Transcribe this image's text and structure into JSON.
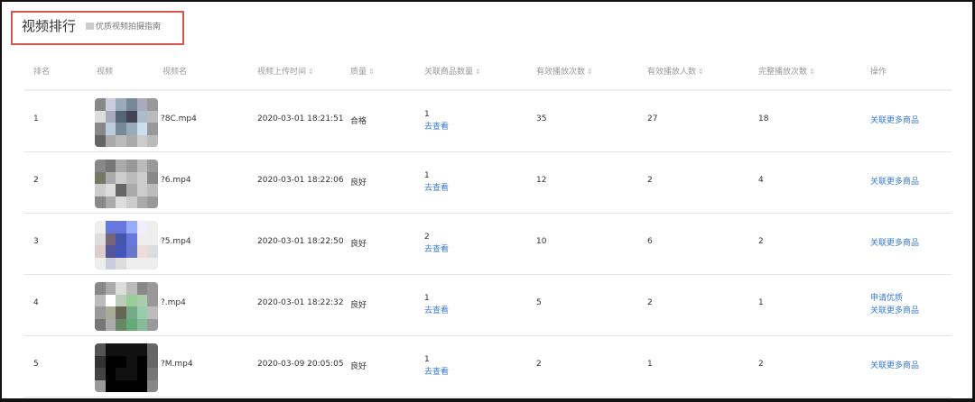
{
  "header": {
    "title": "视频排行",
    "guide_link": "优质视频拍摄指南"
  },
  "columns": [
    {
      "label": "排名",
      "sortable": false
    },
    {
      "label": "视频",
      "sortable": false
    },
    {
      "label": "视频名",
      "sortable": false
    },
    {
      "label": "视频上传时间",
      "sortable": true
    },
    {
      "label": "质量",
      "sortable": true
    },
    {
      "label": "关联商品数量",
      "sortable": true
    },
    {
      "label": "有效播放次数",
      "sortable": true
    },
    {
      "label": "有效播放人数",
      "sortable": true
    },
    {
      "label": "完整播放次数",
      "sortable": true
    },
    {
      "label": "操作",
      "sortable": false
    }
  ],
  "sort_icon": "⇕",
  "rows": [
    {
      "rank": "1",
      "name": "?8C.mp4",
      "time": "2020-03-01 18:21:51",
      "quality": "合格",
      "goods": "1",
      "view": "去查看",
      "plays": "35",
      "viewers": "27",
      "full": "18",
      "actions": [
        "关联更多商品"
      ],
      "thumb": [
        "#888",
        "#ccd",
        "#9ab",
        "#789",
        "#aab",
        "#999",
        "#ddd",
        "#aab",
        "#567",
        "#445",
        "#abc",
        "#bbb",
        "#888",
        "#bcd",
        "#789",
        "#9ab",
        "#cde",
        "#999",
        "#666",
        "#aaa",
        "#bbb",
        "#aaa",
        "#ccc",
        "#bbb"
      ]
    },
    {
      "rank": "2",
      "name": "?6.mp4",
      "time": "2020-03-01 18:22:06",
      "quality": "良好",
      "goods": "1",
      "view": "去查看",
      "plays": "12",
      "viewers": "2",
      "full": "4",
      "actions": [
        "关联更多商品"
      ],
      "thumb": [
        "#888",
        "#777",
        "#aaa",
        "#999",
        "#bbb",
        "#999",
        "#776",
        "#aaa",
        "#ccc",
        "#bbb",
        "#ccc",
        "#888",
        "#ccc",
        "#ddd",
        "#666",
        "#aaa",
        "#ccc",
        "#bbb",
        "#888",
        "#aaa",
        "#ddd",
        "#ccc",
        "#aaa",
        "#999"
      ]
    },
    {
      "rank": "3",
      "name": "?5.mp4",
      "time": "2020-03-01 18:22:50",
      "quality": "良好",
      "goods": "2",
      "view": "去查看",
      "plays": "10",
      "viewers": "6",
      "full": "2",
      "actions": [
        "关联更多商品"
      ],
      "thumb": [
        "#eee",
        "#67d",
        "#67d",
        "#9af",
        "#eef",
        "#eee",
        "#ddd",
        "#767",
        "#45a",
        "#67d",
        "#eee",
        "#eee",
        "#dcc",
        "#559",
        "#45b",
        "#67c",
        "#edd",
        "#ddd",
        "#eee",
        "#ccd",
        "#ddd",
        "#eee",
        "#eee",
        "#eee"
      ]
    },
    {
      "rank": "4",
      "name": "?.mp4",
      "time": "2020-03-01 18:22:32",
      "quality": "良好",
      "goods": "1",
      "view": "去查看",
      "plays": "5",
      "viewers": "2",
      "full": "1",
      "actions": [
        "申请优质",
        "关联更多商品"
      ],
      "thumb": [
        "#888",
        "#aaa",
        "#ddd",
        "#bbb",
        "#888",
        "#999",
        "#bbb",
        "#fff",
        "#bcb",
        "#9c9",
        "#aca",
        "#999",
        "#999",
        "#aa9",
        "#665",
        "#7a8",
        "#9ca",
        "#bbb",
        "#777",
        "#aaa",
        "#686",
        "#6a7",
        "#8b9",
        "#999"
      ]
    },
    {
      "rank": "5",
      "name": "?M.mp4",
      "time": "2020-03-09 20:05:05",
      "quality": "良好",
      "goods": "1",
      "view": "去查看",
      "plays": "2",
      "viewers": "1",
      "full": "2",
      "actions": [
        "关联更多商品"
      ],
      "thumb": [
        "#555",
        "#111",
        "#111",
        "#111",
        "#111",
        "#666",
        "#333",
        "#000",
        "#000",
        "#111",
        "#000",
        "#666",
        "#444",
        "#000",
        "#111",
        "#111",
        "#000",
        "#777",
        "#999",
        "#000",
        "#000",
        "#000",
        "#000",
        "#888"
      ]
    }
  ]
}
